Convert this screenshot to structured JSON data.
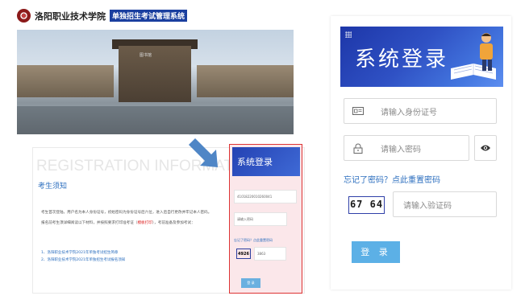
{
  "left_page": {
    "school_name": "洛阳职业技术学院",
    "system_banner": "单独招生考试管理系统",
    "reg_heading": "REGISTRATION INFORMATION",
    "notice_title": "考生须知",
    "notice_line1": "考生首次登陆，用户名为本人身份证号，初始密码为身份证号后六位，进入后自行更改并牢记本人密码。",
    "notice_line2_before": "报名前考生须详细阅读以下材料，并按照要求打印准考证（",
    "notice_line2_red": "模板打印",
    "notice_line2_after": "），考前准备及参加考试：",
    "links": [
      "1、洛阳职业技术学院2021年单独考试招生简章",
      "2、洛阳职业技术学院2021年单独招生考试报名须知"
    ],
    "photo_sign": "图书馆",
    "mini_login": {
      "title": "系统登录",
      "id_value": "41018220010260041",
      "password_placeholder": "请输入密码",
      "forgot": "忘记了密码？点此重置密码",
      "captcha": "4926",
      "captcha_value": "3863",
      "login": "登 录"
    }
  },
  "login_panel": {
    "title": "系统登录",
    "id_placeholder": "请输入身份证号",
    "password_placeholder": "请输入密码",
    "forgot_link": "忘记了密码？点此重置密码",
    "captcha_text": "67 64",
    "captcha_placeholder": "请输入验证码",
    "login_button": "登 录"
  },
  "colors": {
    "accent_blue": "#2d6fbf",
    "banner_blue": "#2f51c4",
    "button_blue": "#5cb0e6",
    "highlight_red": "#dd3333"
  },
  "icons": [
    "id-card-icon",
    "lock-icon",
    "eye-icon",
    "arrow-icon",
    "school-seal-icon"
  ]
}
